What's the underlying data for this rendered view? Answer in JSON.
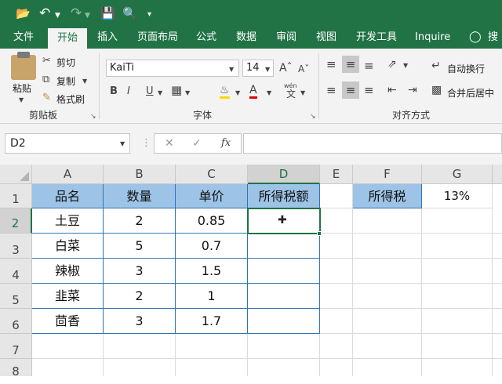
{
  "ribbon_tabs": [
    "文件",
    "开始",
    "插入",
    "页面布局",
    "公式",
    "数据",
    "审阅",
    "视图",
    "开发工具",
    "Inquire",
    "搜"
  ],
  "clipboard": {
    "paste": "粘贴",
    "cut": "剪切",
    "copy": "复制",
    "format_painter": "格式刷",
    "group": "剪贴板"
  },
  "font": {
    "name": "KaiTi",
    "size": "14",
    "bold": "B",
    "italic": "I",
    "underline": "U",
    "color_a": "A",
    "wen": "wén",
    "wen_char": "文",
    "group": "字体"
  },
  "alignment": {
    "wrap_text": "自动换行",
    "merge_center": "合并后居中",
    "group": "对齐方式"
  },
  "formula_bar": {
    "name_box": "D2",
    "fx": "fx",
    "value": ""
  },
  "colors": {
    "excel_green": "#217346",
    "header_fill": "#9dc3e6",
    "border_blue": "#2e75b6"
  },
  "columns": [
    "A",
    "B",
    "C",
    "D",
    "E",
    "F",
    "G"
  ],
  "rows": [
    "1",
    "2",
    "3",
    "4",
    "5",
    "6",
    "7",
    "8"
  ],
  "table": {
    "headers": [
      "品名",
      "数量",
      "单价",
      "所得税额"
    ],
    "rows": [
      [
        "土豆",
        "2",
        "0.85",
        ""
      ],
      [
        "白菜",
        "5",
        "0.7",
        ""
      ],
      [
        "辣椒",
        "3",
        "1.5",
        ""
      ],
      [
        "韭菜",
        "2",
        "1",
        ""
      ],
      [
        "茴香",
        "3",
        "1.7",
        ""
      ]
    ]
  },
  "tax": {
    "label": "所得税",
    "rate": "13%"
  }
}
